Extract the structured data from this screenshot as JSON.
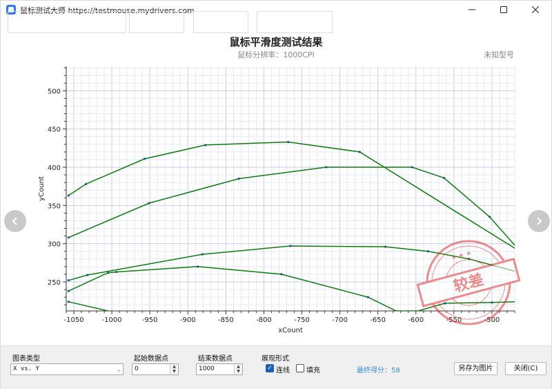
{
  "window": {
    "title": "鼠标测试大师 https://testmouse.mydrivers.com",
    "controls": [
      "minimize",
      "maximize",
      "close"
    ]
  },
  "chart": {
    "title": "鼠标平滑度测试结果",
    "subtitle": "鼠标分辨率：1000CPI",
    "model": "未知型号",
    "stamp_text": "较差",
    "stamp_color": "#e03030",
    "line_color": "#0a7d0a"
  },
  "chart_data": {
    "type": "line",
    "xlabel": "xCount",
    "ylabel": "yCount",
    "xlim": [
      -1060,
      -470
    ],
    "ylim": [
      212,
      532
    ],
    "x_ticks": [
      -1050,
      -1000,
      -950,
      -900,
      -850,
      -800,
      -750,
      -700,
      -650,
      -600,
      -550,
      -500
    ],
    "y_ticks": [
      250,
      300,
      350,
      400,
      450,
      500
    ],
    "grid": true,
    "series": [
      {
        "x": [
          -1057,
          -1034,
          -957,
          -877,
          -768,
          -674,
          -470
        ],
        "y": [
          363,
          378,
          411,
          429,
          433,
          420,
          294
        ]
      },
      {
        "x": [
          -1057,
          -951,
          -833,
          -718,
          -605,
          -563,
          -503,
          -470
        ],
        "y": [
          308,
          353,
          385,
          400,
          400,
          386,
          335,
          298
        ]
      },
      {
        "x": [
          -1057,
          -1032,
          -881,
          -765,
          -640,
          -584,
          -530,
          -470
        ],
        "y": [
          252,
          259,
          286,
          297,
          296,
          290,
          280,
          264
        ]
      },
      {
        "x": [
          -1057,
          -1005,
          -994,
          -887,
          -777,
          -663,
          -626,
          -597,
          -562,
          -500,
          -470
        ],
        "y": [
          238,
          262,
          263,
          270,
          260,
          230,
          212,
          212,
          222,
          223,
          224
        ]
      },
      {
        "x": [
          -1057,
          -1005
        ],
        "y": [
          224,
          212
        ]
      }
    ]
  },
  "controls": {
    "chart_type": {
      "label": "图表类型",
      "value": "X vs. Y"
    },
    "start": {
      "label": "起始数据点",
      "value": "0"
    },
    "end": {
      "label": "结束数据点",
      "value": "1000"
    },
    "style": {
      "label": "展现形式",
      "line_label": "连线",
      "line_checked": true,
      "fill_label": "填充",
      "fill_checked": false
    },
    "score": "最终得分：58",
    "save_label": "另存为图片",
    "close_label": "关闭(C)"
  }
}
